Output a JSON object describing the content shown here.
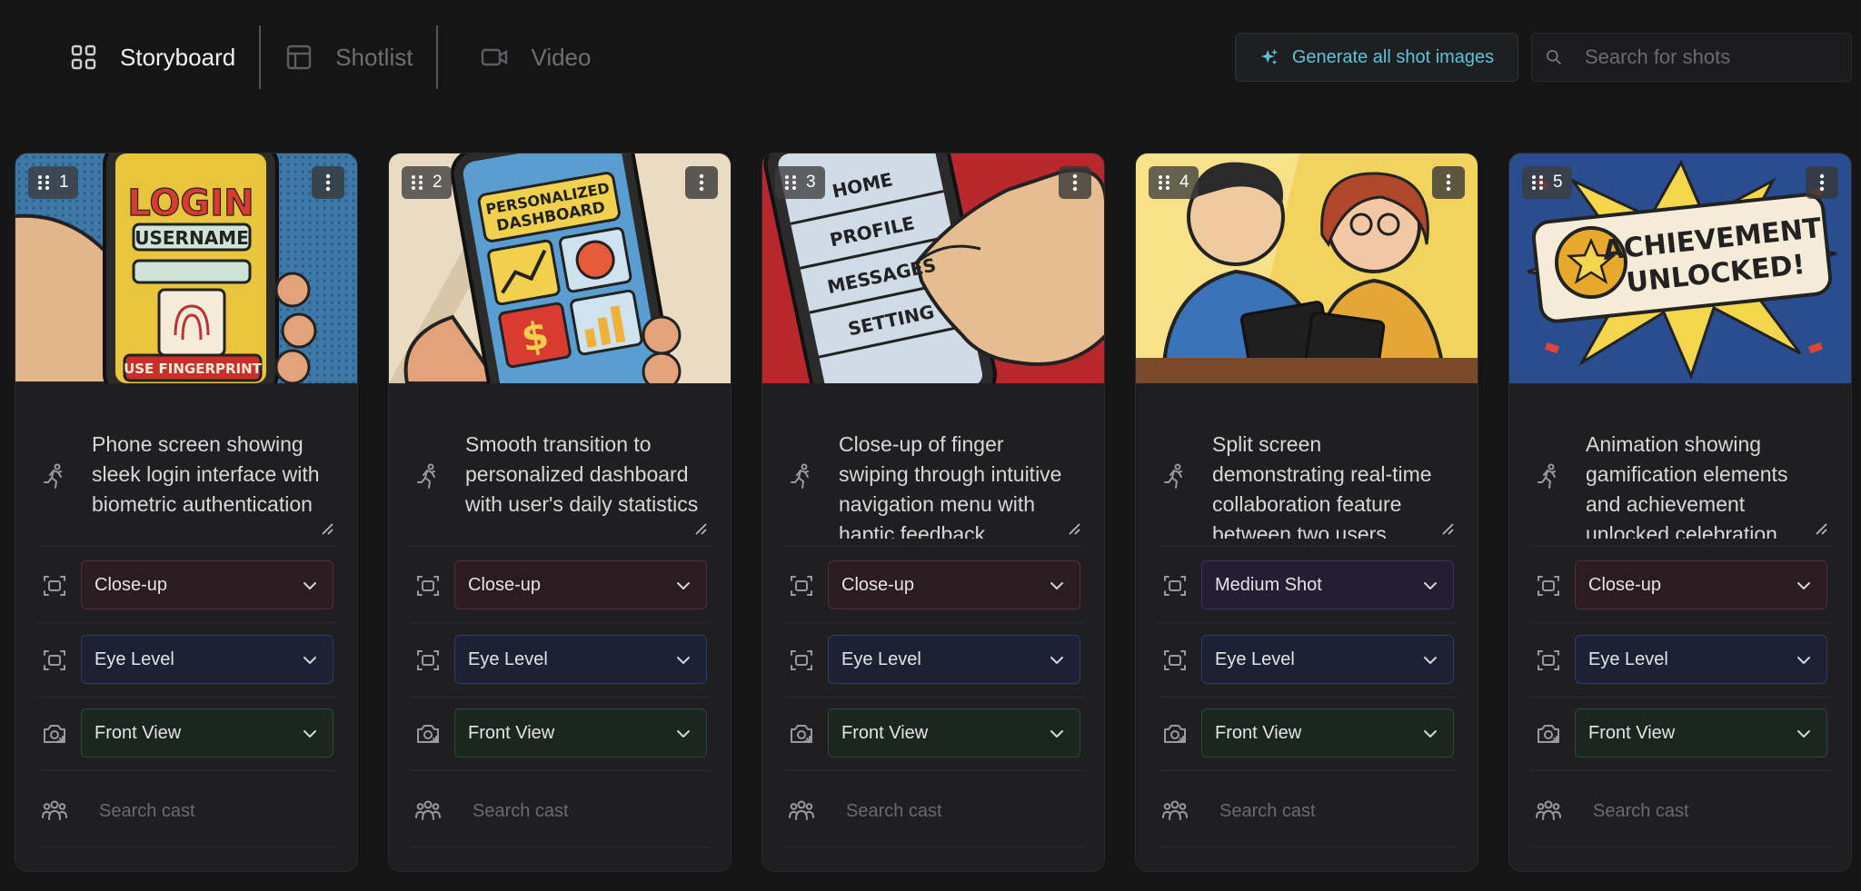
{
  "tabs": [
    {
      "label": "Storyboard",
      "icon": "grid-icon",
      "active": true
    },
    {
      "label": "Shotlist",
      "icon": "table-icon",
      "active": false
    },
    {
      "label": "Video",
      "icon": "video-camera-icon",
      "active": false
    }
  ],
  "header": {
    "generate_label": "Generate all shot images",
    "search_placeholder": "Search for shots"
  },
  "colors": {
    "accent": "#5dc3d9",
    "closeup_red": "#5a2c34",
    "medium_purple": "#3f3163",
    "eye_blue": "#2e3c66",
    "front_green": "#2d4a35"
  },
  "shots": [
    {
      "number": "1",
      "image_text": [
        "LOGIN",
        "USERNAME",
        "USE FINGERPRINT"
      ],
      "description": "Phone screen showing sleek login interface with biometric authentication",
      "shot_type": "Close-up",
      "camera_angle": "Eye Level",
      "view": "Front View",
      "cast_placeholder": "Search cast"
    },
    {
      "number": "2",
      "image_text": [
        "PERSONALIZED",
        "DASHBOARD"
      ],
      "description": "Smooth transition to personalized dashboard with user's daily statistics",
      "shot_type": "Close-up",
      "camera_angle": "Eye Level",
      "view": "Front View",
      "cast_placeholder": "Search cast"
    },
    {
      "number": "3",
      "image_text": [
        "HOME",
        "PROFILE",
        "MESSAGES",
        "SETTING"
      ],
      "description": "Close-up of finger swiping through intuitive navigation menu with haptic feedback",
      "shot_type": "Close-up",
      "camera_angle": "Eye Level",
      "view": "Front View",
      "cast_placeholder": "Search cast"
    },
    {
      "number": "4",
      "image_text": [],
      "description": "Split screen demonstrating real-time collaboration feature between two users",
      "shot_type": "Medium Shot",
      "camera_angle": "Eye Level",
      "view": "Front View",
      "cast_placeholder": "Search cast"
    },
    {
      "number": "5",
      "image_text": [
        "ACHIEVEMENT",
        "UNLOCKED!"
      ],
      "description": "Animation showing gamification elements and achievement unlocked celebration",
      "shot_type": "Close-up",
      "camera_angle": "Eye Level",
      "view": "Front View",
      "cast_placeholder": "Search cast"
    }
  ]
}
